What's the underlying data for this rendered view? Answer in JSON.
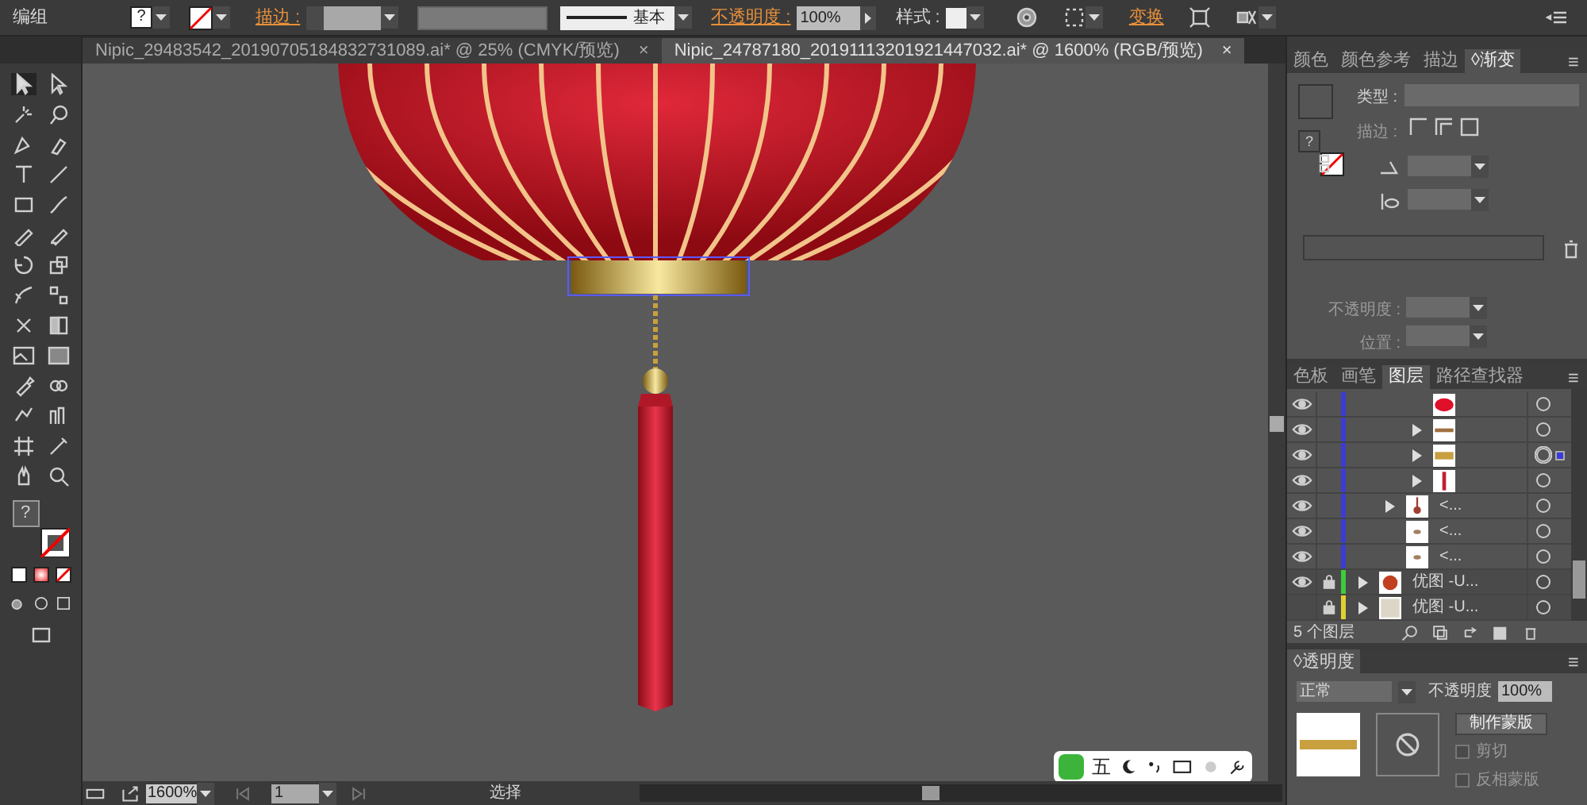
{
  "control_bar": {
    "selection_label": "编组",
    "fill_indicator": "?",
    "stroke_label": "描边 :",
    "stroke_style": "基本",
    "opacity_label": "不透明度 :",
    "opacity_value": "100%",
    "style_label": "样式 :",
    "transform_link": "变换"
  },
  "document_tabs": [
    {
      "title": "Nipic_29483542_20190705184832731089.ai* @ 25% (CMYK/预览)",
      "close": "×",
      "selected": false
    },
    {
      "title": "Nipic_24787180_20191113201921447032.ai* @ 1600% (RGB/预览)",
      "close": "×",
      "selected": true
    }
  ],
  "tools": {
    "fill_indicator": "?"
  },
  "gradient_panel": {
    "tabs": [
      {
        "label": "颜色",
        "selected": false
      },
      {
        "label": "颜色参考",
        "selected": false
      },
      {
        "label": "描边",
        "selected": false
      },
      {
        "label": "◊渐变",
        "selected": true
      }
    ],
    "fill_indicator": "?",
    "type_label": "类型 :",
    "stroke_label": "描边 :",
    "opacity_label": "不透明度 :",
    "position_label": "位置 :"
  },
  "layers_panel": {
    "tabs": [
      {
        "label": "色板",
        "selected": false
      },
      {
        "label": "画笔",
        "selected": false
      },
      {
        "label": "图层",
        "selected": true
      },
      {
        "label": "路径查找器",
        "selected": false
      }
    ],
    "rows": [
      {
        "children": [
          {
            "children": [
              {
                "visible": true,
                "locked": false,
                "color": "#3c3cd2",
                "expandable": false,
                "kind": "ellipse",
                "selected": false
              },
              {
                "visible": true,
                "locked": false,
                "color": "#3c3cd2",
                "expandable": true,
                "kind": "band",
                "selected": false
              },
              {
                "visible": true,
                "locked": false,
                "color": "#3c3cd2",
                "expandable": true,
                "kind": "ring",
                "selected": true
              },
              {
                "visible": true,
                "locked": false,
                "color": "#3c3cd2",
                "expandable": true,
                "kind": "tassel",
                "selected": false
              }
            ]
          },
          {
            "visible": true,
            "locked": false,
            "color": "#3c3cd2",
            "expandable": true,
            "kind": "chain",
            "name": "<...",
            "selected": false
          },
          {
            "visible": true,
            "locked": false,
            "color": "#3c3cd2",
            "expandable": false,
            "kind": "dot",
            "name": "<...",
            "selected": false
          },
          {
            "visible": true,
            "locked": false,
            "color": "#3c3cd2",
            "expandable": false,
            "kind": "dot",
            "name": "<...",
            "selected": false
          }
        ]
      },
      {
        "visible": true,
        "locked": true,
        "color": "#3ccc3c",
        "expandable": true,
        "kind": "art",
        "name": "优图 -U...",
        "selected": false
      },
      {
        "visible": false,
        "locked": true,
        "color": "#e0d030",
        "expandable": true,
        "kind": "plain",
        "name": "优图 -U...",
        "selected": false
      }
    ],
    "count": "5 个图层"
  },
  "transparency_panel": {
    "tab": "◊透明度",
    "blend_mode": "正常",
    "opacity_label": "不透明度",
    "opacity_value": "100%",
    "make_mask_button": "制作蒙版",
    "options": [
      {
        "label": "剪切",
        "checked": false
      },
      {
        "label": "反相蒙版",
        "checked": false
      }
    ]
  },
  "status_bar": {
    "zoom": "1600%",
    "artboard": "1",
    "tool": "选择"
  },
  "ime_toolbar": {
    "mode": "五"
  }
}
